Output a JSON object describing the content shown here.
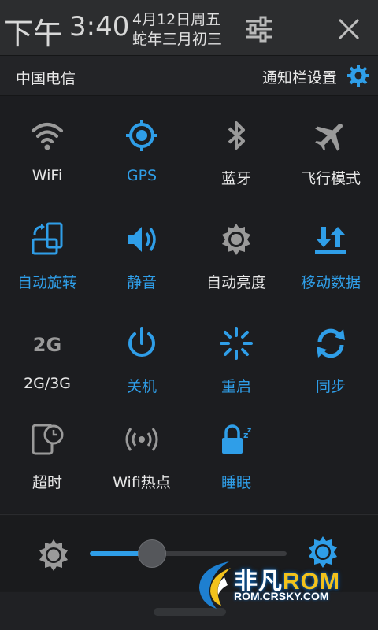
{
  "status": {
    "period": "下午",
    "clock": "3:40",
    "date_line1": "4月12日周五",
    "date_line2": "蛇年三月初三"
  },
  "header": {
    "carrier": "中国电信",
    "notification_settings": "通知栏设置"
  },
  "toggles": [
    {
      "label": "WiFi",
      "icon": "wifi-icon",
      "active": false
    },
    {
      "label": "GPS",
      "icon": "gps-icon",
      "active": true
    },
    {
      "label": "蓝牙",
      "icon": "bluetooth-icon",
      "active": false
    },
    {
      "label": "飞行模式",
      "icon": "airplane-icon",
      "active": false
    },
    {
      "label": "自动旋转",
      "icon": "rotate-icon",
      "active": true
    },
    {
      "label": "静音",
      "icon": "volume-icon",
      "active": true
    },
    {
      "label": "自动亮度",
      "icon": "auto-brightness-icon",
      "active": false
    },
    {
      "label": "移动数据",
      "icon": "mobile-data-icon",
      "active": true
    },
    {
      "label": "2G/3G",
      "icon": "network-2g-icon",
      "active": false
    },
    {
      "label": "关机",
      "icon": "power-icon",
      "active": true
    },
    {
      "label": "重启",
      "icon": "restart-icon",
      "active": true
    },
    {
      "label": "同步",
      "icon": "sync-icon",
      "active": true
    },
    {
      "label": "超时",
      "icon": "timeout-icon",
      "active": false
    },
    {
      "label": "Wifi热点",
      "icon": "hotspot-icon",
      "active": false
    },
    {
      "label": "睡眠",
      "icon": "sleep-icon",
      "active": true
    }
  ],
  "brightness": {
    "level": 0.31
  },
  "watermark": {
    "main_a": "非凡",
    "main_b": "ROM",
    "url": "ROM.CRSKY.COM"
  },
  "colors": {
    "accent": "#2f9ee8",
    "inactive": "#9a9a9a"
  }
}
